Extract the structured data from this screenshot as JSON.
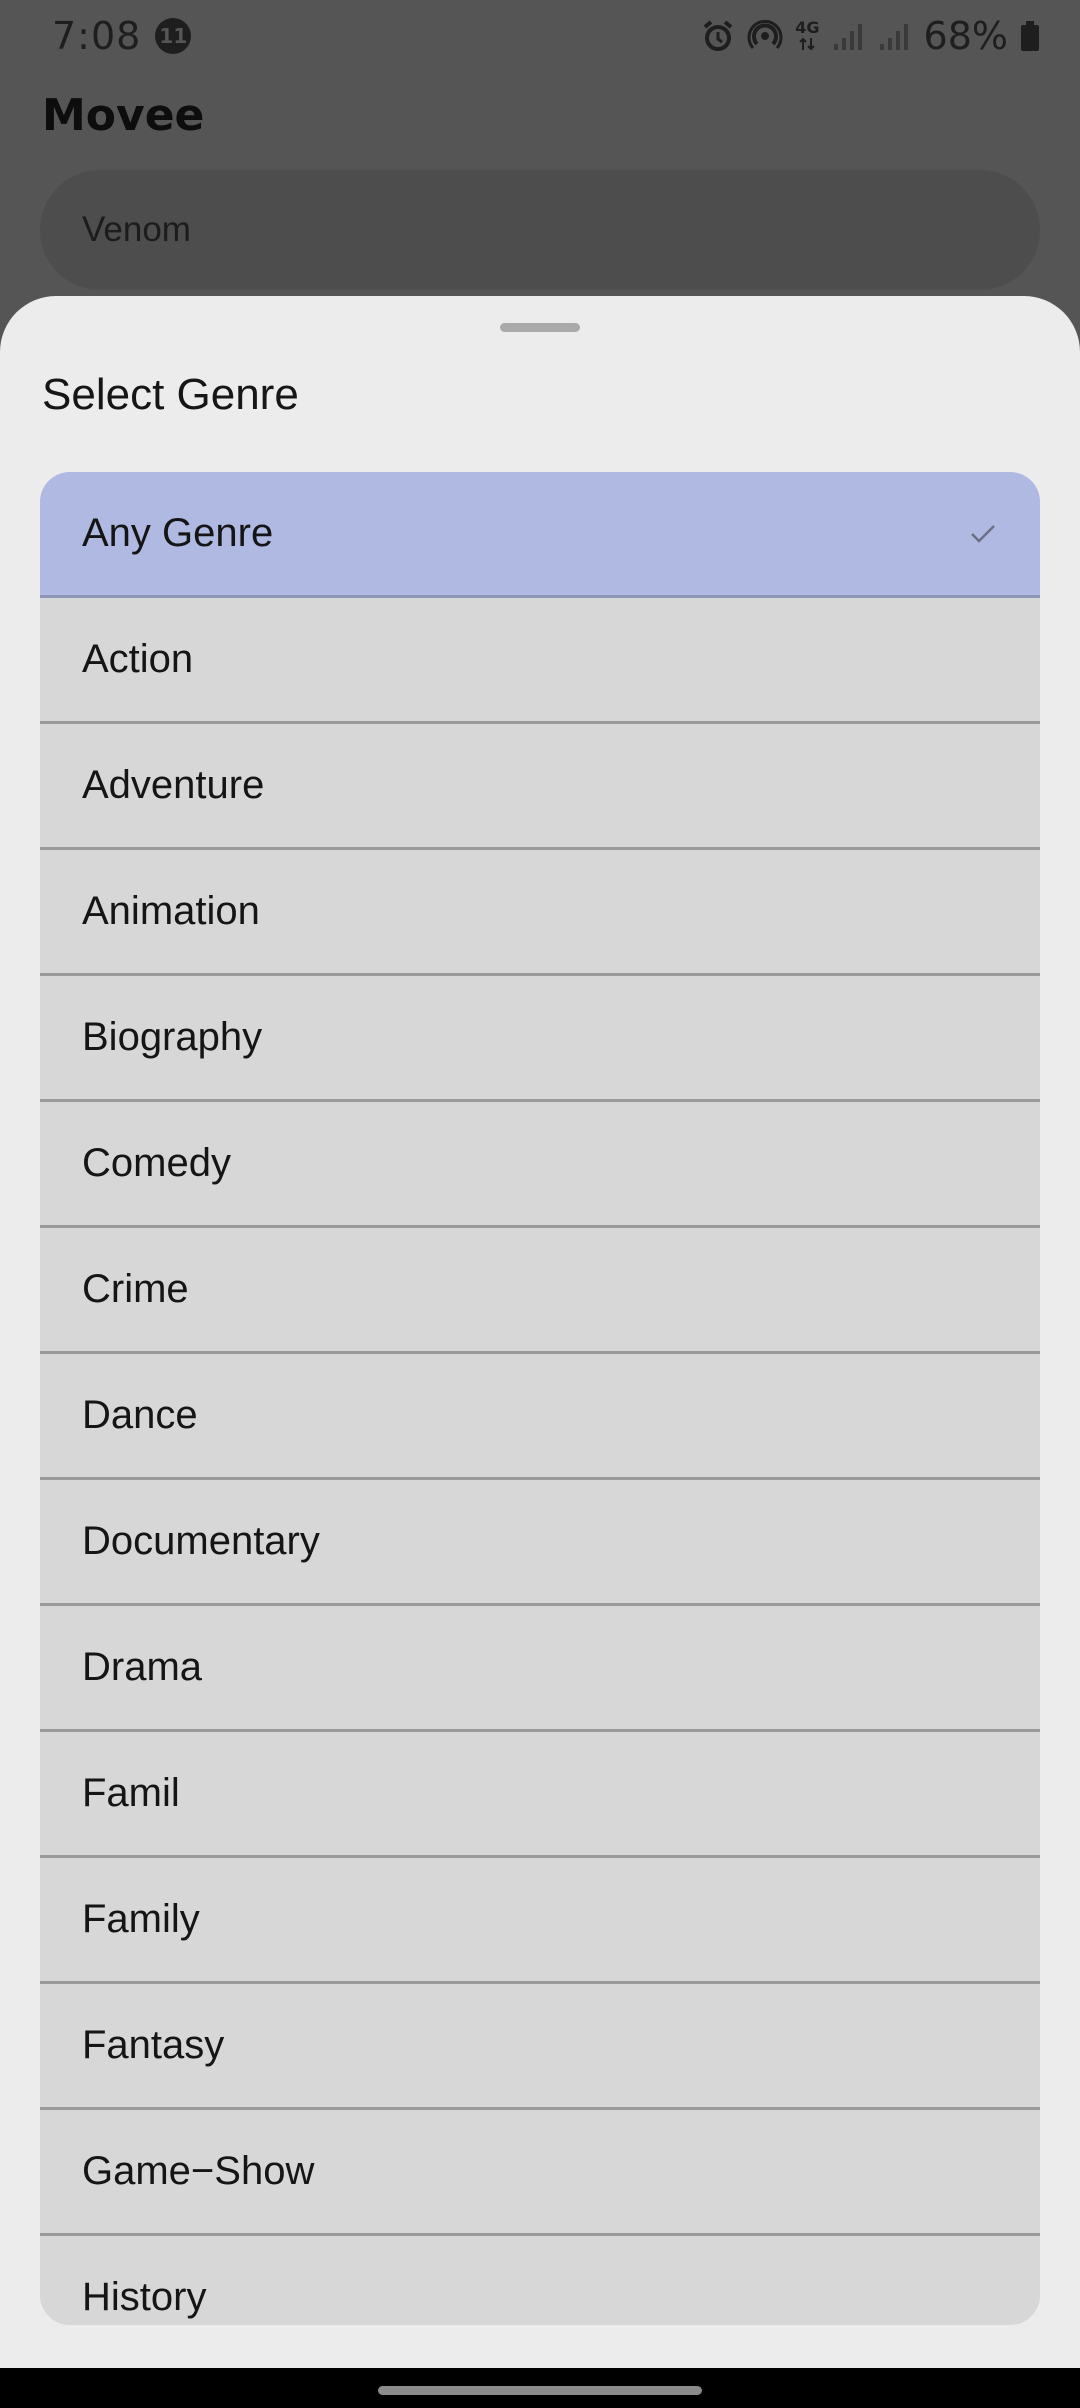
{
  "status_bar": {
    "time": "7:08",
    "notification_count": "11",
    "network_label": "4G",
    "battery": "68%"
  },
  "app": {
    "title": "Movee",
    "search": {
      "value": "Venom"
    }
  },
  "sheet": {
    "title": "Select Genre",
    "selected_genre": "Any Genre",
    "genres": [
      "Any Genre",
      "Action",
      "Adventure",
      "Animation",
      "Biography",
      "Comedy",
      "Crime",
      "Dance",
      "Documentary",
      "Drama",
      "Famil",
      "Family",
      "Fantasy",
      "Game−Show",
      "History"
    ]
  },
  "colors": {
    "scrim": "#555555",
    "sheet_background": "#ececec",
    "list_item_background": "#d7d7d7",
    "selected_item_background": "#afb9e1"
  },
  "icons": [
    "alarm-icon",
    "hotspot-icon",
    "network-4g-icon",
    "signal-icon",
    "battery-icon",
    "check-icon"
  ]
}
